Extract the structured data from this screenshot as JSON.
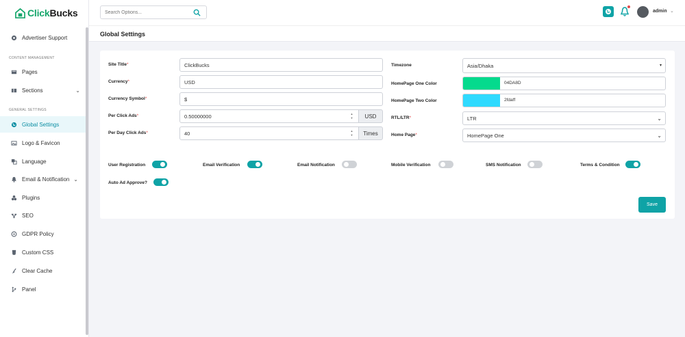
{
  "brand": {
    "name_part1": "Click",
    "name_part2": "Bucks",
    "accent": "#15a66b"
  },
  "sidebar": {
    "top_item": {
      "label": "Advertiser Support",
      "icon": "gear-icon"
    },
    "heading_content": "CONTENT MANAGEMENT",
    "content_items": [
      {
        "label": "Pages",
        "icon": "pages-icon"
      },
      {
        "label": "Sections",
        "icon": "sections-icon",
        "expandable": true
      }
    ],
    "heading_general": "GENERAL SETTINGS",
    "general_items": [
      {
        "label": "Global Settings",
        "icon": "globe-icon",
        "active": true
      },
      {
        "label": "Logo & Favicon",
        "icon": "image-icon"
      },
      {
        "label": "Language",
        "icon": "language-icon"
      },
      {
        "label": "Email & Notification",
        "icon": "bell-icon",
        "expandable": true
      },
      {
        "label": "Plugins",
        "icon": "plugins-icon"
      },
      {
        "label": "SEO",
        "icon": "seo-icon"
      },
      {
        "label": "GDPR Policy",
        "icon": "gdpr-icon"
      },
      {
        "label": "Custom CSS",
        "icon": "css-icon"
      },
      {
        "label": "Clear Cache",
        "icon": "broom-icon"
      },
      {
        "label": "Panel",
        "icon": "panel-icon"
      }
    ]
  },
  "topbar": {
    "search_placeholder": "Search Options...",
    "user_name": "admin",
    "notification_dot": true
  },
  "page": {
    "title": "Global Settings"
  },
  "form": {
    "site_title": {
      "label": "Site Title",
      "value": "ClickBucks"
    },
    "currency": {
      "label": "Currency",
      "value": "USD"
    },
    "currency_symbol": {
      "label": "Currency Symbol",
      "value": "$"
    },
    "per_click_ads": {
      "label": "Per Click Ads",
      "value": "0.50000000",
      "addon": "USD"
    },
    "per_day_click_ads": {
      "label": "Per Day Click Ads",
      "value": "40",
      "addon": "Times"
    },
    "timezone": {
      "label": "Timezone",
      "value": "Asia/Dhaka"
    },
    "homepage_one_color": {
      "label": "HomePage One Color",
      "value": "04DA8D",
      "swatch": "#04DA8D"
    },
    "homepage_two_color": {
      "label": "HomePage Two Color",
      "value": "2fdaff",
      "swatch": "#2fdaff"
    },
    "rtl_ltr": {
      "label": "RTL/LTR",
      "value": "LTR"
    },
    "home_page": {
      "label": "Home Page",
      "value": "HomePage One"
    }
  },
  "toggles": [
    {
      "label": "User Registration",
      "on": true
    },
    {
      "label": "Email Verification",
      "on": true
    },
    {
      "label": "Email Notification",
      "on": false
    },
    {
      "label": "Mobile Verification",
      "on": false
    },
    {
      "label": "SMS Notification",
      "on": false
    },
    {
      "label": "Terms & Condition",
      "on": true
    },
    {
      "label": "Auto Ad Approve?",
      "on": true
    }
  ],
  "actions": {
    "save_label": "Save"
  },
  "colors": {
    "primary": "#0fa3a6",
    "danger": "#e34b4b"
  }
}
